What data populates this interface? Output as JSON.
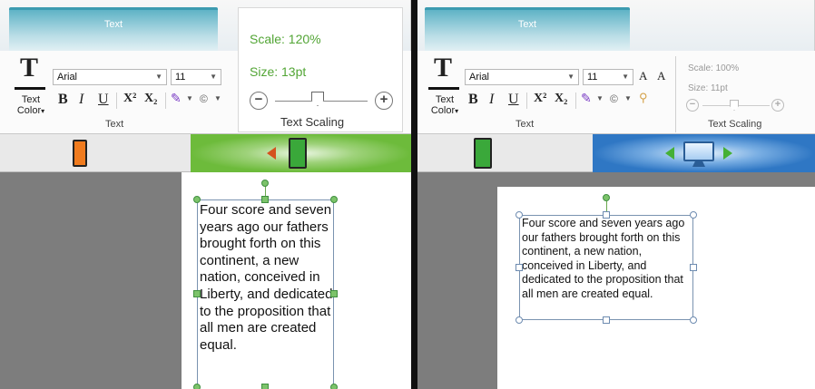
{
  "left": {
    "ribbon": {
      "tab_label": "Text",
      "text_color_label": "Text Color",
      "text_color_arrow": "▾",
      "font_name": "Arial",
      "font_size": "11",
      "bold": "B",
      "italic": "I",
      "underline": "U",
      "superscript": "X²",
      "subscript": "X₂",
      "group_label": "Text",
      "scale_text": "Scale: 120%",
      "size_text": "Size: 13pt",
      "scaling_group_label": "Text Scaling",
      "minus": "−",
      "plus": "+"
    },
    "body_text": "Four score and seven years ago our fathers brought forth on this continent, a new nation, conceived in Liberty, and dedicated to the proposition that all men are created equal."
  },
  "right": {
    "ribbon": {
      "tab_label": "Text",
      "text_color_label": "Text Color",
      "text_color_arrow": "▾",
      "font_name": "Arial",
      "font_size": "11",
      "grow": "A",
      "shrink": "A",
      "bold": "B",
      "italic": "I",
      "underline": "U",
      "superscript": "X²",
      "subscript": "X₂",
      "group_label": "Text",
      "scale_text": "Scale: 100%",
      "size_text": "Size: 11pt",
      "scaling_group_label": "Text Scaling",
      "minus": "−",
      "plus": "+"
    },
    "body_text": "Four score and seven years ago our fathers brought forth on this continent, a new nation, conceived in Liberty, and dedicated to the proposition that all men are created equal."
  },
  "colors": {
    "accent_green": "#6dbb3b",
    "accent_blue": "#2f77c4",
    "phone_orange": "#f07b1e",
    "phone_green": "#3aa83a",
    "scale_green": "#52a535",
    "arrow_orange": "#d4521e"
  },
  "icons": {
    "phone": "phone-icon",
    "tablet": "tablet-icon",
    "monitor": "monitor-icon",
    "highlight": "highlighter-icon",
    "symbol": "copyright-icon",
    "link": "link-icon"
  }
}
